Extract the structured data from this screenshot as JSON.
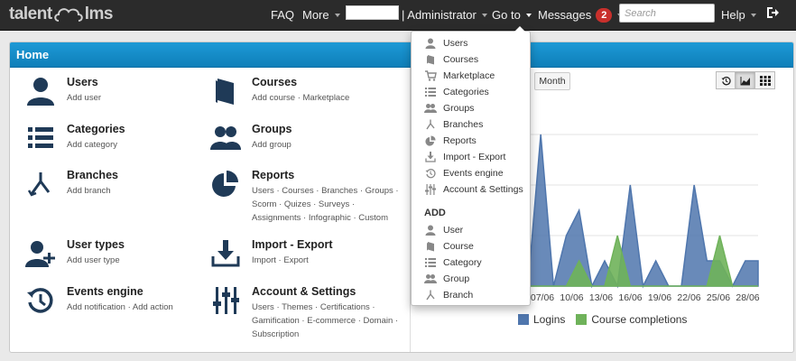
{
  "topbar": {
    "logo_left": "talent",
    "logo_right": "lms",
    "faq": "FAQ",
    "more": "More",
    "role": "| Administrator",
    "goto": "Go to",
    "messages": "Messages",
    "messages_count": "2",
    "search_placeholder": "Search",
    "help": "Help"
  },
  "panel": {
    "title": "Home"
  },
  "tiles": [
    {
      "title": "Users",
      "sub": "Add user",
      "icon": "user-icon"
    },
    {
      "title": "Courses",
      "sub": "Add course · Marketplace",
      "icon": "book-icon"
    },
    {
      "title": "Categories",
      "sub": "Add category",
      "icon": "list-icon"
    },
    {
      "title": "Groups",
      "sub": "Add group",
      "icon": "group-icon"
    },
    {
      "title": "Branches",
      "sub": "Add branch",
      "icon": "branch-icon"
    },
    {
      "title": "Reports",
      "sub": "Users · Courses · Branches · Groups · Scorm · Quizes · Surveys · Assignments · Infographic · Custom",
      "icon": "pie-chart-icon"
    },
    {
      "title": "User types",
      "sub": "Add user type",
      "icon": "user-plus-icon"
    },
    {
      "title": "Import - Export",
      "sub": "Import · Export",
      "icon": "download-icon"
    },
    {
      "title": "Events engine",
      "sub": "Add notification · Add action",
      "icon": "history-icon"
    },
    {
      "title": "Account & Settings",
      "sub": "Users · Themes · Certifications · Gamification · E-commerce · Domain · Subscription",
      "icon": "sliders-icon"
    }
  ],
  "goto_menu": {
    "items": [
      "Users",
      "Courses",
      "Marketplace",
      "Categories",
      "Groups",
      "Branches",
      "Reports",
      "Import - Export",
      "Events engine",
      "Account & Settings"
    ],
    "add_heading": "ADD",
    "add_items": [
      "User",
      "Course",
      "Category",
      "Group",
      "Branch"
    ]
  },
  "chart_controls": {
    "month": "Month"
  },
  "chart_data": {
    "type": "area",
    "x_ticks": [
      "07/06",
      "10/06",
      "13/06",
      "16/06",
      "19/06",
      "22/06",
      "25/06",
      "28/06"
    ],
    "series": [
      {
        "name": "Logins",
        "color": "#4f76ad",
        "values": [
          0,
          6,
          0,
          2,
          3,
          0,
          1,
          0,
          4,
          0,
          1,
          0,
          0,
          4,
          1,
          1,
          0,
          1,
          1
        ]
      },
      {
        "name": "Course completions",
        "color": "#6fb25a",
        "values": [
          0,
          0,
          0,
          0,
          1,
          0,
          0,
          2,
          0,
          0,
          0,
          0,
          0,
          0,
          0,
          2,
          0,
          0,
          0
        ]
      }
    ]
  }
}
